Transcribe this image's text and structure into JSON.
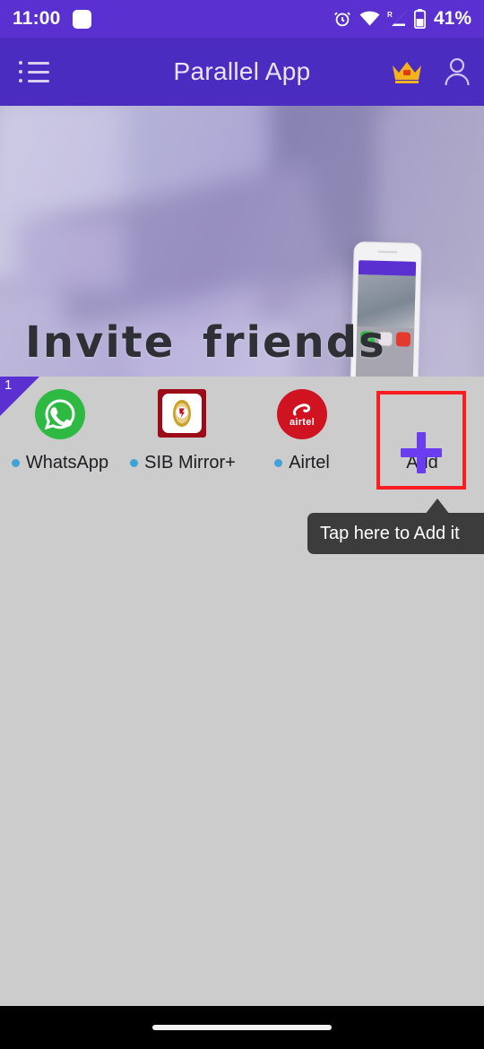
{
  "status_bar": {
    "time": "11:00",
    "battery_percent": "41%",
    "icons": [
      "square-icon",
      "alarm-clock-icon",
      "wifi-icon",
      "signal-roaming-icon",
      "battery-icon"
    ],
    "roaming_label": "R",
    "background_color": "#5a30d0"
  },
  "app_bar": {
    "title": "Parallel App",
    "menu_icon": "list-menu-icon",
    "crown_icon": "crown-icon",
    "profile_icon": "person-icon",
    "background_color": "#4a2cc0"
  },
  "banner": {
    "title": "Invite friends",
    "title_color": "#2f3036",
    "image": "blurred-desk-workspace-photo-with-phone-mockup"
  },
  "apps_section": {
    "badge_count": "1",
    "items": [
      {
        "label": "WhatsApp",
        "icon": "whatsapp-icon",
        "icon_color": "#2eb943",
        "dot_color": "#3fa3d8"
      },
      {
        "label": "SIB Mirror+",
        "icon": "sib-mirror-icon",
        "icon_color": "#9c0b17",
        "dot_color": "#3fa3d8"
      },
      {
        "label": "Airtel",
        "icon": "airtel-icon",
        "icon_color": "#d01321",
        "dot_color": "#3fa3d8"
      }
    ],
    "add_button": {
      "label": "Add",
      "icon": "plus-icon",
      "plus_color": "#6a3df0",
      "highlight_color": "#fa1d20"
    }
  },
  "tooltip": {
    "text": "Tap here to Add it",
    "background_color": "#3c3c3c"
  },
  "nav_bar": {
    "gesture_pill": "home-gesture-pill"
  }
}
